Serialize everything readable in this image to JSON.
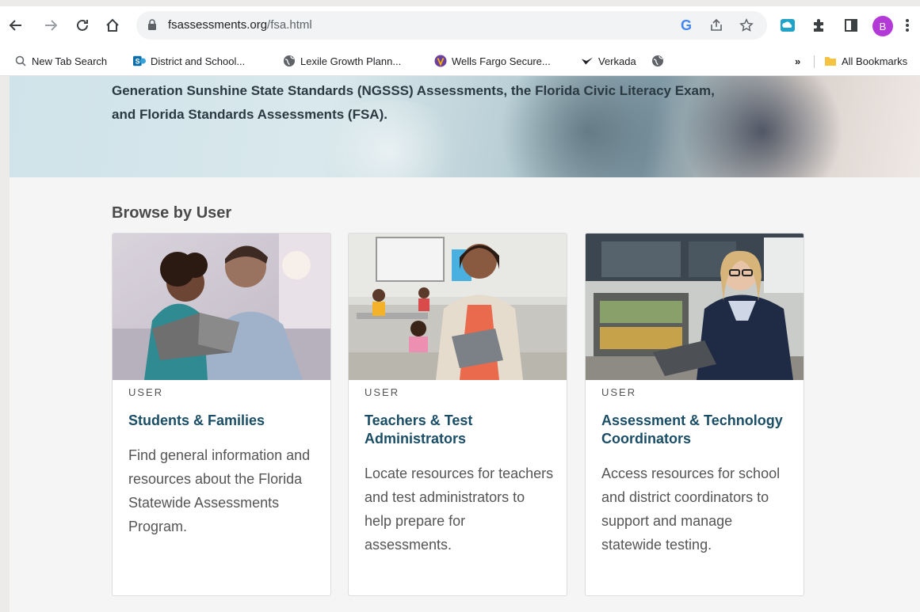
{
  "browser": {
    "url_host": "fsassessments.org",
    "url_path": "/fsa.html",
    "avatar_letter": "B",
    "bookmarks": [
      {
        "label": "New Tab Search",
        "icon": "search-icon"
      },
      {
        "label": "District and School...",
        "icon": "sharepoint-icon"
      },
      {
        "label": "Lexile Growth Plann...",
        "icon": "globe-icon"
      },
      {
        "label": "Wells Fargo Secure...",
        "icon": "wells-fargo-icon"
      },
      {
        "label": "Verkada",
        "icon": "verkada-icon"
      },
      {
        "label": "",
        "icon": "globe-icon"
      }
    ],
    "more_bookmarks": "»",
    "all_bookmarks": "All Bookmarks"
  },
  "page": {
    "hero_text_line1": "Generation Sunshine State Standards (NGSSS) Assessments, the Florida Civic Literacy Exam,",
    "hero_text_line2": "and Florida Standards Assessments (FSA).",
    "section_title": "Browse by User",
    "cards": [
      {
        "kicker": "USER",
        "title": "Students & Families",
        "description": "Find general information and resources about the Florida Statewide Assessments Program."
      },
      {
        "kicker": "USER",
        "title": "Teachers & Test Administrators",
        "description": "Locate resources for teachers and test administrators to help prepare for assessments."
      },
      {
        "kicker": "USER",
        "title": "Assessment & Technology Coordinators",
        "description": "Access resources for school and district coordinators to support and manage statewide testing."
      }
    ]
  },
  "colors": {
    "card_title": "#1a4d66",
    "avatar": "#b33ad6",
    "page_bg": "#f5f5f5"
  }
}
